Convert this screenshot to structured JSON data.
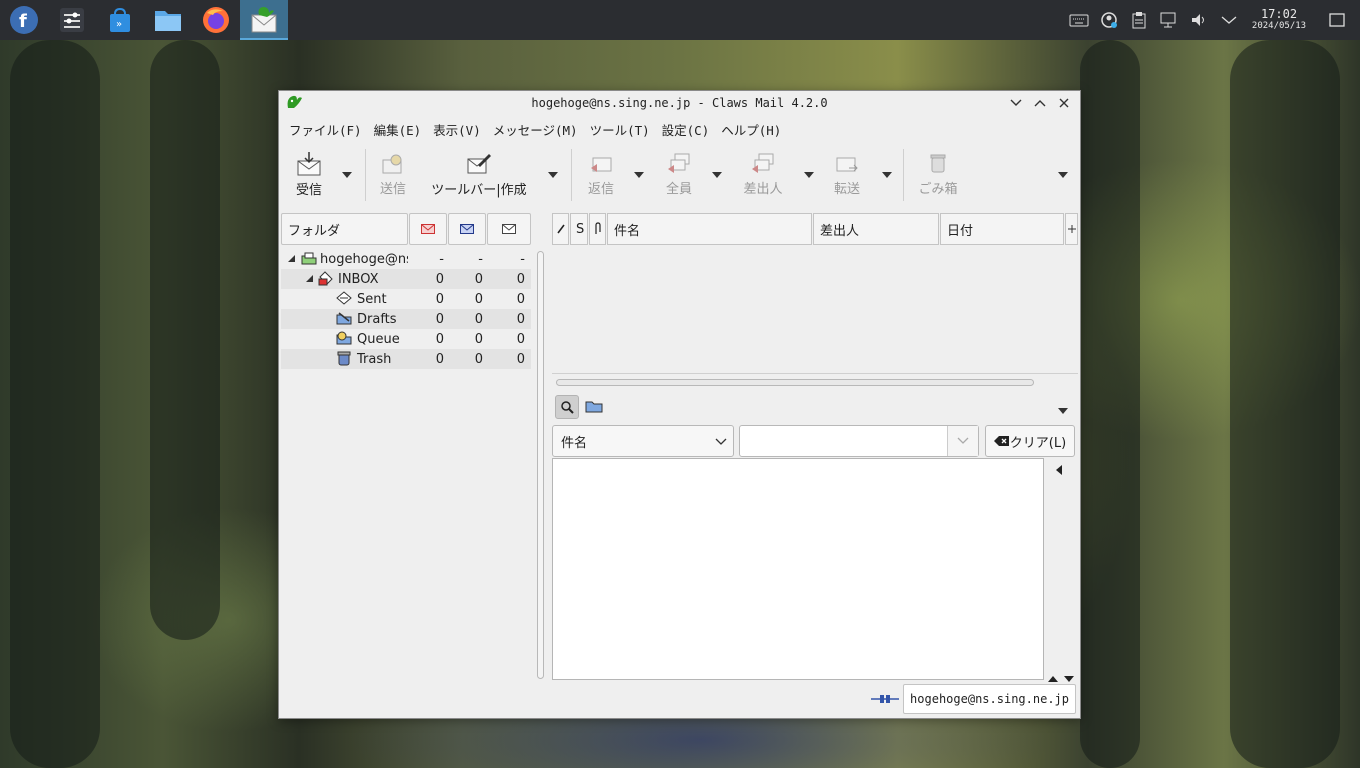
{
  "window": {
    "title": "hogehoge@ns.sing.ne.jp - Claws Mail 4.2.0"
  },
  "menubar": {
    "items": [
      "ファイル(F)",
      "編集(E)",
      "表示(V)",
      "メッセージ(M)",
      "ツール(T)",
      "設定(C)",
      "ヘルプ(H)"
    ]
  },
  "toolbar": {
    "receive": "受信",
    "send": "送信",
    "compose": "ツールバー|作成",
    "reply": "返信",
    "reply_all": "全員",
    "reply_sender": "差出人",
    "forward": "転送",
    "trash": "ごみ箱"
  },
  "folder_pane": {
    "header": "フォルダ",
    "rows": [
      {
        "name": "hogehoge@ns",
        "new": "-",
        "unread": "-",
        "total": "-"
      },
      {
        "name": "INBOX",
        "new": "0",
        "unread": "0",
        "total": "0"
      },
      {
        "name": "Sent",
        "new": "0",
        "unread": "0",
        "total": "0"
      },
      {
        "name": "Drafts",
        "new": "0",
        "unread": "0",
        "total": "0"
      },
      {
        "name": "Queue",
        "new": "0",
        "unread": "0",
        "total": "0"
      },
      {
        "name": "Trash",
        "new": "0",
        "unread": "0",
        "total": "0"
      }
    ]
  },
  "message_list": {
    "col_s": "S",
    "col_subject": "件名",
    "col_from": "差出人",
    "col_date": "日付"
  },
  "search": {
    "field": "件名",
    "query": "",
    "clear": "クリア(L)"
  },
  "statusbar": {
    "account": "hogehoge@ns.sing.ne.jp"
  },
  "taskbar": {
    "time": "17:02",
    "date": "2024/05/13"
  },
  "colors": {
    "taskbar": "#2b2d31",
    "active_app": "#3d6f8f",
    "window_bg": "#efefef"
  }
}
